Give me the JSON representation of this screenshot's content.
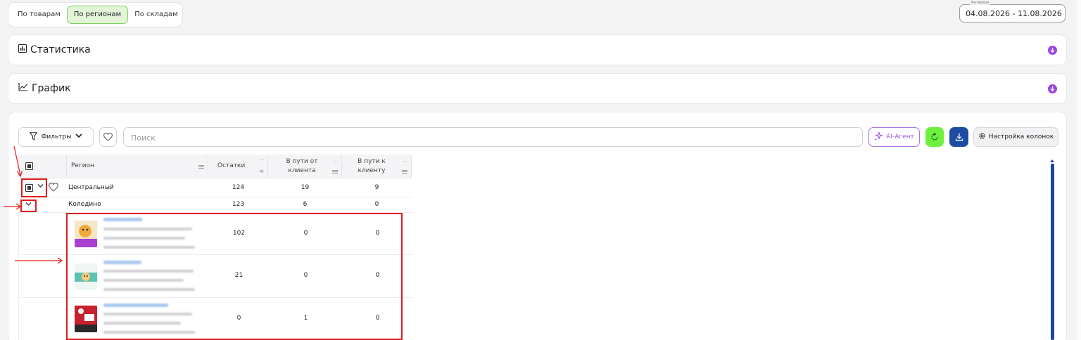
{
  "view_tabs": {
    "items": [
      "По товарам",
      "По регионам",
      "По складам"
    ],
    "active_index": 1
  },
  "date_range": {
    "caption": "Интервал",
    "value": "04.08.2026 - 11.08.2026"
  },
  "panels": {
    "statistics_title": "Статистика",
    "chart_title": "График"
  },
  "toolbar": {
    "filter_label": "Фильтры",
    "search_placeholder": "Поиск",
    "ai_label": "AI-Агент",
    "columns_label": "Настройка колонок"
  },
  "table": {
    "columns": {
      "region": "Регион",
      "stock": "Остатки",
      "from_client": "В пути от клиента",
      "to_client": "В пути к клиенту"
    },
    "region_row": {
      "name": "Центральный",
      "stock": "124",
      "from_client": "19",
      "to_client": "9"
    },
    "warehouse_row": {
      "name": "Коледино",
      "stock": "123",
      "from_client": "6",
      "to_client": "0"
    },
    "products": [
      {
        "stock": "102",
        "from_client": "0",
        "to_client": "0"
      },
      {
        "stock": "21",
        "from_client": "0",
        "to_client": "0"
      },
      {
        "stock": "0",
        "from_client": "1",
        "to_client": "0"
      }
    ]
  },
  "colors": {
    "accent_purple": "#9b45e0",
    "active_tab_green": "#7ed061",
    "refresh_green": "#6ef03f",
    "download_blue": "#1c4da3",
    "annotation_red": "#e21b1b"
  }
}
